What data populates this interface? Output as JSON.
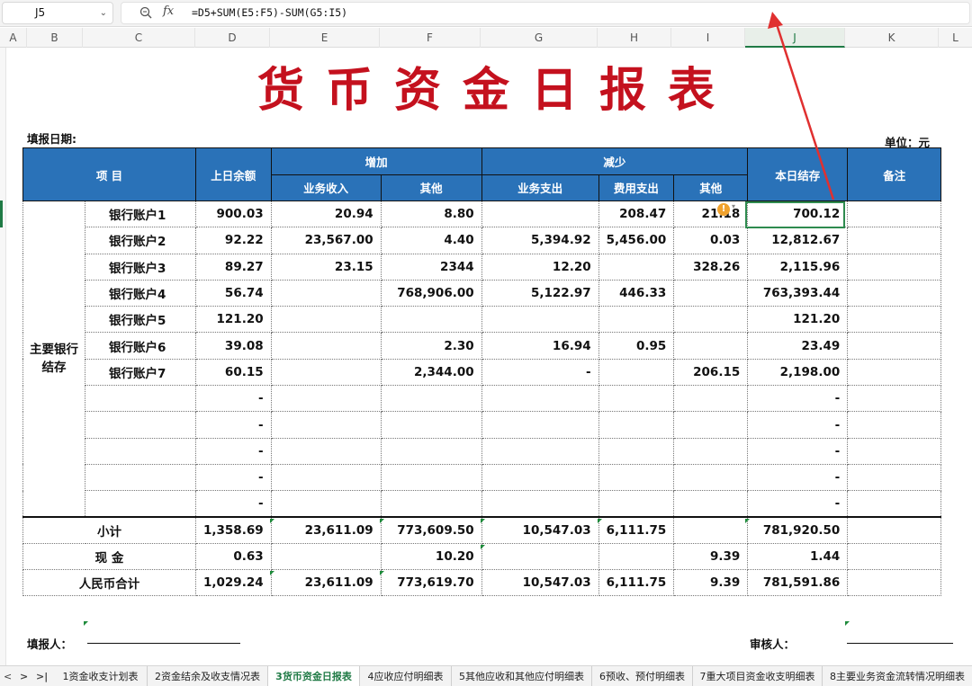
{
  "formula_bar": {
    "cell_ref": "J5",
    "formula": "=D5+SUM(E5:F5)-SUM(G5:I5)",
    "fx_label": "fx"
  },
  "columns": [
    "A",
    "B",
    "C",
    "D",
    "E",
    "F",
    "G",
    "H",
    "I",
    "J",
    "K",
    "L"
  ],
  "sheet": {
    "title": "货币资金日报表",
    "fill_date_label": "填报日期:",
    "unit_label": "单位：元",
    "headers": {
      "item": "项  目",
      "prev_balance": "上日余额",
      "increase": "增加",
      "decrease": "减少",
      "today_balance": "本日结存",
      "remark": "备注",
      "business_income": "业务收入",
      "other_in": "其他",
      "business_expense": "业务支出",
      "fee_expense": "费用支出",
      "other_out": "其他"
    },
    "group_label": "主要银行结存",
    "rows": [
      {
        "name": "银行账户1",
        "d": "900.03",
        "e": "20.94",
        "f": "8.80",
        "g": "",
        "h": "208.47",
        "i": "21.18",
        "j": "700.12"
      },
      {
        "name": "银行账户2",
        "d": "92.22",
        "e": "23,567.00",
        "f": "4.40",
        "g": "5,394.92",
        "h": "5,456.00",
        "i": "0.03",
        "j": "12,812.67"
      },
      {
        "name": "银行账户3",
        "d": "89.27",
        "e": "23.15",
        "f": "2344",
        "g": "12.20",
        "h": "",
        "i": "328.26",
        "j": "2,115.96"
      },
      {
        "name": "银行账户4",
        "d": "56.74",
        "e": "",
        "f": "768,906.00",
        "g": "5,122.97",
        "h": "446.33",
        "i": "",
        "j": "763,393.44"
      },
      {
        "name": "银行账户5",
        "d": "121.20",
        "e": "",
        "f": "",
        "g": "",
        "h": "",
        "i": "",
        "j": "121.20"
      },
      {
        "name": "银行账户6",
        "d": "39.08",
        "e": "",
        "f": "2.30",
        "g": "16.94",
        "h": "0.95",
        "i": "",
        "j": "23.49"
      },
      {
        "name": "银行账户7",
        "d": "60.15",
        "e": "",
        "f": "2,344.00",
        "g": "-",
        "h": "",
        "i": "206.15",
        "j": "2,198.00"
      },
      {
        "name": "",
        "d": "-",
        "e": "",
        "f": "",
        "g": "",
        "h": "",
        "i": "",
        "j": "-"
      },
      {
        "name": "",
        "d": "-",
        "e": "",
        "f": "",
        "g": "",
        "h": "",
        "i": "",
        "j": "-"
      },
      {
        "name": "",
        "d": "-",
        "e": "",
        "f": "",
        "g": "",
        "h": "",
        "i": "",
        "j": "-"
      },
      {
        "name": "",
        "d": "-",
        "e": "",
        "f": "",
        "g": "",
        "h": "",
        "i": "",
        "j": "-"
      },
      {
        "name": "",
        "d": "-",
        "e": "",
        "f": "",
        "g": "",
        "h": "",
        "i": "",
        "j": "-"
      }
    ],
    "subtotal": {
      "label": "小计",
      "d": "1,358.69",
      "e": "23,611.09",
      "f": "773,609.50",
      "g": "10,547.03",
      "h": "6,111.75",
      "i": "",
      "j": "781,920.50"
    },
    "cash": {
      "label": "现  金",
      "d": "0.63",
      "e": "",
      "f": "10.20",
      "g": "",
      "h": "",
      "i": "9.39",
      "j": "1.44"
    },
    "total": {
      "label": "人民币合计",
      "d": "1,029.24",
      "e": "23,611.09",
      "f": "773,619.70",
      "g": "10,547.03",
      "h": "6,111.75",
      "i": "9.39",
      "j": "781,591.86"
    },
    "reporter_label": "填报人：",
    "reviewer_label": "审核人："
  },
  "tabs": [
    "1资金收支计划表",
    "2资金结余及收支情况表",
    "3货币资金日报表",
    "4应收应付明细表",
    "5其他应收和其他应付明细表",
    "6预收、预付明细表",
    "7重大项目资金收支明细表",
    "8主要业务资金流转情况明细表"
  ],
  "active_tab": "3货币资金日报表",
  "colors": {
    "title_red": "#c4111e",
    "header_blue": "#2a72b8",
    "select_green": "#2e8b4f",
    "arrow_red": "#e03030"
  }
}
